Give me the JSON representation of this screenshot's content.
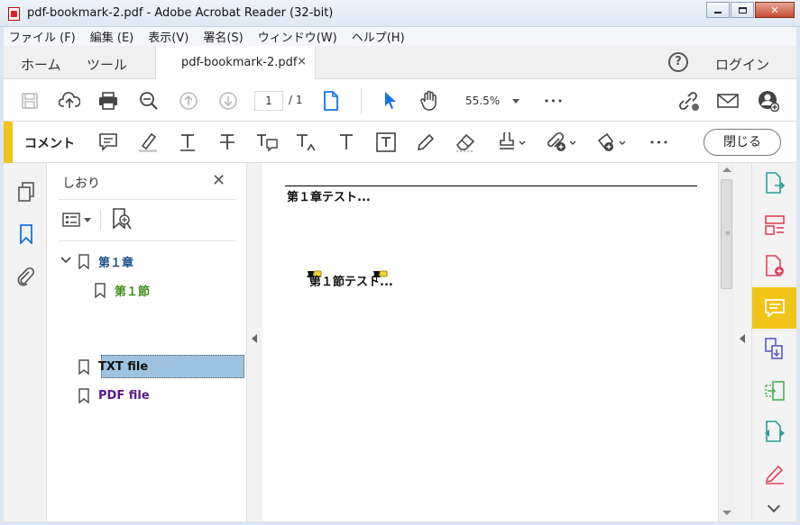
{
  "window": {
    "title": "pdf-bookmark-2.pdf - Adobe Acrobat Reader (32-bit)",
    "minimize_icon": "minimize-icon",
    "maximize_icon": "maximize-icon",
    "close_icon": "close-icon"
  },
  "menu": [
    "ファイル (F)",
    "編集 (E)",
    "表示(V)",
    "署名(S)",
    "ウィンドウ(W)",
    "ヘルプ(H)"
  ],
  "tabs": {
    "home": "ホーム",
    "tools": "ツール",
    "document": "pdf-bookmark-2.pdf",
    "close_glyph": "×",
    "help_glyph": "?",
    "login": "ログイン"
  },
  "toolbar": {
    "page_current": "1",
    "page_total": "/ 1",
    "zoom": "55.5%",
    "more_glyph": "•••",
    "icons": [
      "save-icon",
      "upload-icon",
      "print-icon",
      "zoom-search-icon",
      "previous-page-icon",
      "next-page-icon",
      "page-icon",
      "select-pointer-icon",
      "hand-icon",
      "more-icon",
      "share-link-icon",
      "email-icon",
      "add-user-icon"
    ]
  },
  "commentbar": {
    "title": "コメント",
    "close_label": "閉じる",
    "more_glyph": "•••",
    "tools": [
      "sticky-note-icon",
      "highlight-icon",
      "underline-icon",
      "strikethrough-icon",
      "replace-text-icon",
      "insert-text-icon",
      "add-text-icon",
      "text-box-icon",
      "pencil-icon",
      "eraser-icon",
      "stamp-icon",
      "attach-file-icon",
      "shapes-icon",
      "more-icon"
    ]
  },
  "leftrail": {
    "icons": [
      "page-thumbnails-icon",
      "bookmarks-icon",
      "attachments-icon"
    ]
  },
  "bookmarks": {
    "title": "しおり",
    "close_glyph": "✕",
    "items": [
      {
        "label": "第１章",
        "color": "#1a4f8a",
        "expanded": true,
        "level": 0
      },
      {
        "label": "第１節",
        "color": "#3f8f1a",
        "level": 1
      },
      {
        "label": "TXT file",
        "color": "#111111",
        "selected": true,
        "level": 0
      },
      {
        "label": "PDF file",
        "color": "#5a1a8a",
        "level": 0
      }
    ],
    "chevron_glyph": "﹀"
  },
  "document": {
    "heading": "第１章テスト...",
    "subheading": "第１節テスト..."
  },
  "rightrail": {
    "icons": [
      "export-pdf-icon",
      "organize-pages-icon",
      "create-pdf-icon",
      "comment-icon",
      "combine-files-icon",
      "compress-icon",
      "edit-pdf-icon",
      "fill-sign-icon"
    ],
    "active": "comment-icon"
  },
  "colors": {
    "accent_yellow": "#f0c419",
    "selection": "#9dc3e0",
    "brand_red": "#d9272e"
  }
}
